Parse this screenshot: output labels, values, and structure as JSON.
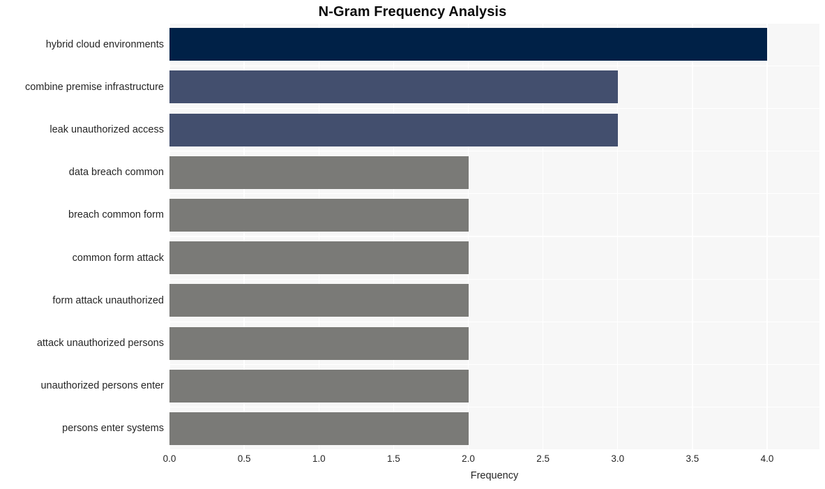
{
  "chart_data": {
    "type": "bar",
    "orientation": "horizontal",
    "title": "N-Gram Frequency Analysis",
    "xlabel": "Frequency",
    "ylabel": "",
    "categories": [
      "hybrid cloud environments",
      "combine premise infrastructure",
      "leak unauthorized access",
      "data breach common",
      "breach common form",
      "common form attack",
      "form attack unauthorized",
      "attack unauthorized persons",
      "unauthorized persons enter",
      "persons enter systems"
    ],
    "values": [
      4,
      3,
      3,
      2,
      2,
      2,
      2,
      2,
      2,
      2
    ],
    "bar_colors": [
      "#002147",
      "#434f6e",
      "#434f6e",
      "#7a7a77",
      "#7a7a77",
      "#7a7a77",
      "#7a7a77",
      "#7a7a77",
      "#7a7a77",
      "#7a7a77"
    ],
    "xlim": [
      0,
      4.35
    ],
    "xticks": [
      0.0,
      0.5,
      1.0,
      1.5,
      2.0,
      2.5,
      3.0,
      3.5,
      4.0
    ],
    "xtick_labels": [
      "0.0",
      "0.5",
      "1.0",
      "1.5",
      "2.0",
      "2.5",
      "3.0",
      "3.5",
      "4.0"
    ],
    "grid": true,
    "grid_color": "#ffffff",
    "plot_background": "#f7f7f7",
    "figure_background": "#ffffff",
    "legend": null
  }
}
